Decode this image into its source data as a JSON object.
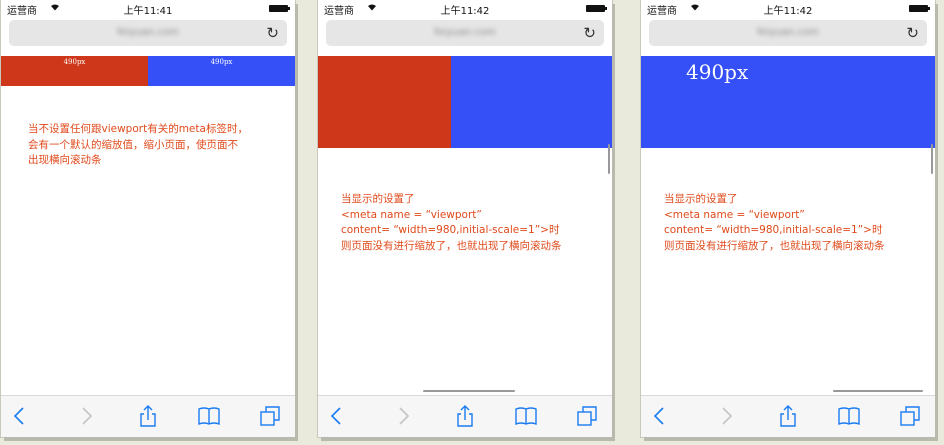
{
  "screens": [
    {
      "status": {
        "carrier": "运营商",
        "time": "上午11:41"
      },
      "url_text": "feiyuan.com",
      "red_label": "490px",
      "blue_label": "490px",
      "note_lines": [
        "当不设置任何跟viewport有关的meta标签时，",
        "会有一个默认的缩放值，缩小页面，使页面不",
        "出现横向滚动条"
      ]
    },
    {
      "status": {
        "carrier": "运营商",
        "time": "上午11:42"
      },
      "url_text": "feiyuan.com",
      "note_lines": [
        "当显示的设置了",
        "<meta name = “viewport”",
        "content= “width=980,initial-scale=1”>时",
        "则页面没有进行缩放了，也就出现了横向滚动条"
      ]
    },
    {
      "status": {
        "carrier": "运营商",
        "time": "上午11:42"
      },
      "url_text": "feiyuan.com",
      "blue_label": "490px",
      "note_lines": [
        "当显示的设置了",
        "<meta name = “viewport”",
        "content= “width=980,initial-scale=1”>时",
        "则页面没有进行缩放了，也就出现了横向滚动条"
      ]
    }
  ],
  "icons": {
    "wifi": "wifi-icon",
    "battery": "battery-icon",
    "reload": "reload-icon",
    "back": "back-arrow-icon",
    "forward": "forward-arrow-icon",
    "share": "share-icon",
    "bookmarks": "bookmarks-icon",
    "tabs": "tabs-icon"
  },
  "colors": {
    "accent": "#1b7cf2",
    "red_block": "#ce3719",
    "blue_block": "#3550f6",
    "note_text": "#e04a1b"
  }
}
